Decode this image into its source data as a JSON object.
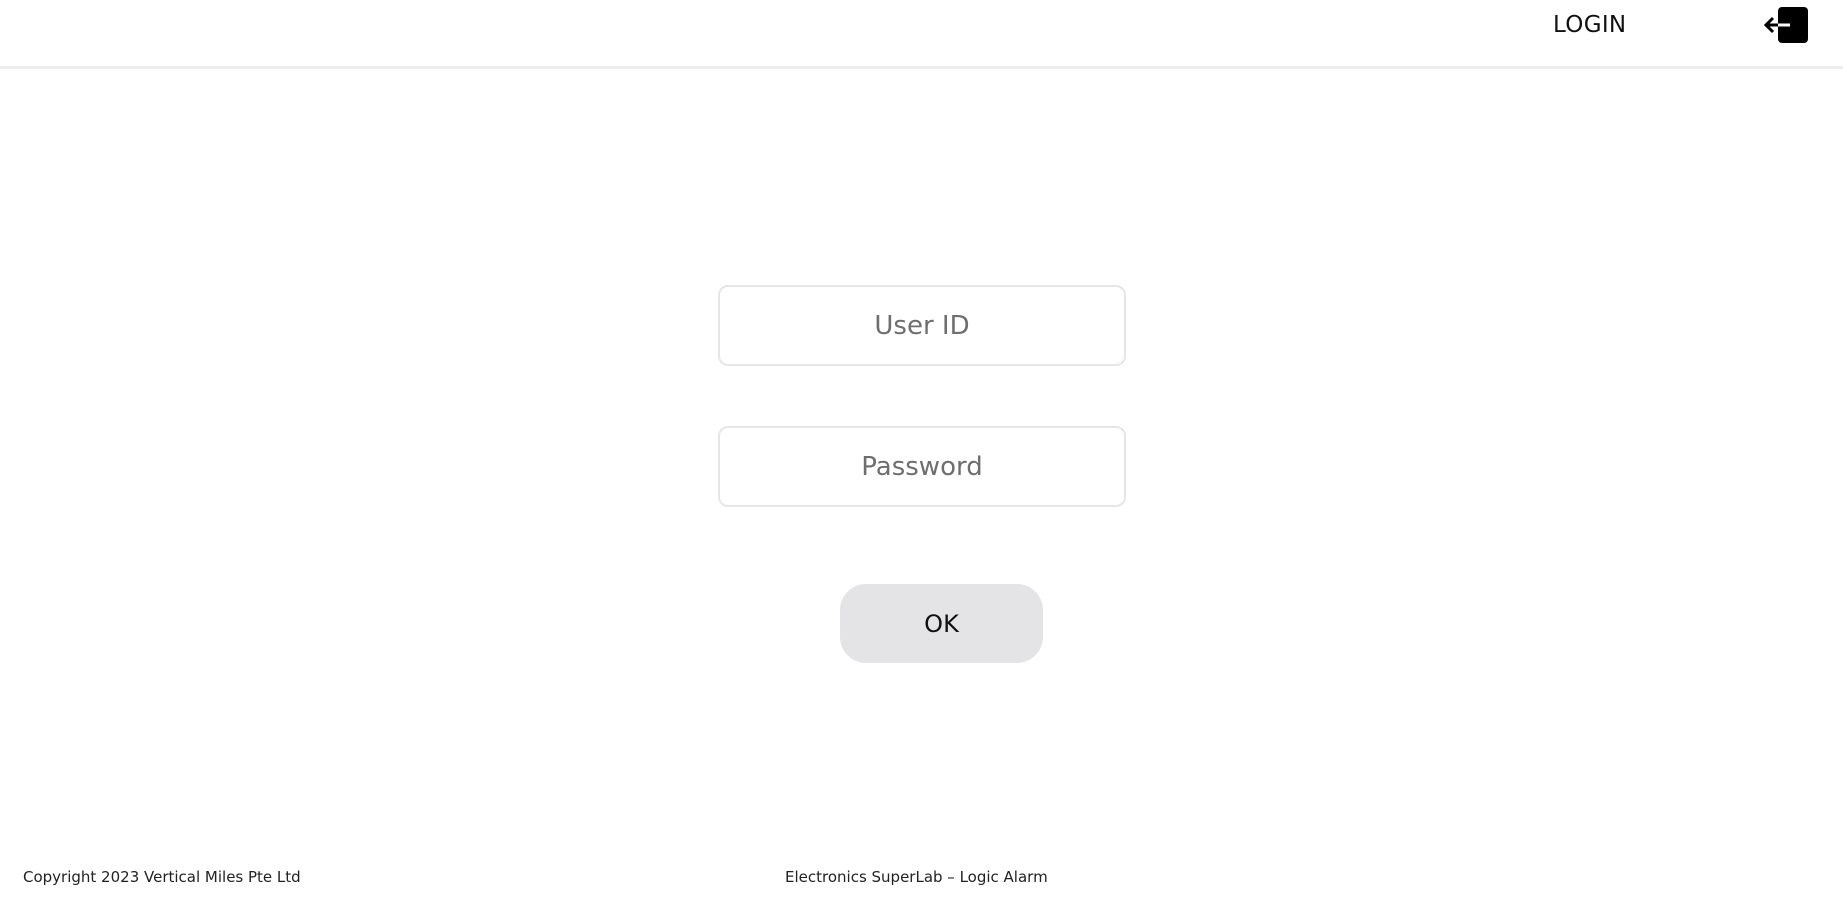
{
  "header": {
    "login_label": "LOGIN",
    "login_icon": "login-exit-icon"
  },
  "form": {
    "userid_placeholder": "User ID",
    "userid_value": "",
    "password_placeholder": "Password",
    "password_value": "",
    "ok_label": "OK"
  },
  "footer": {
    "copyright": "Copyright 2023 Vertical Miles Pte Ltd",
    "app_title": "Electronics SuperLab – Logic Alarm"
  },
  "colors": {
    "button_bg": "#e4e4e6",
    "field_border": "#e6e6e6",
    "header_border": "#eeeeee"
  }
}
